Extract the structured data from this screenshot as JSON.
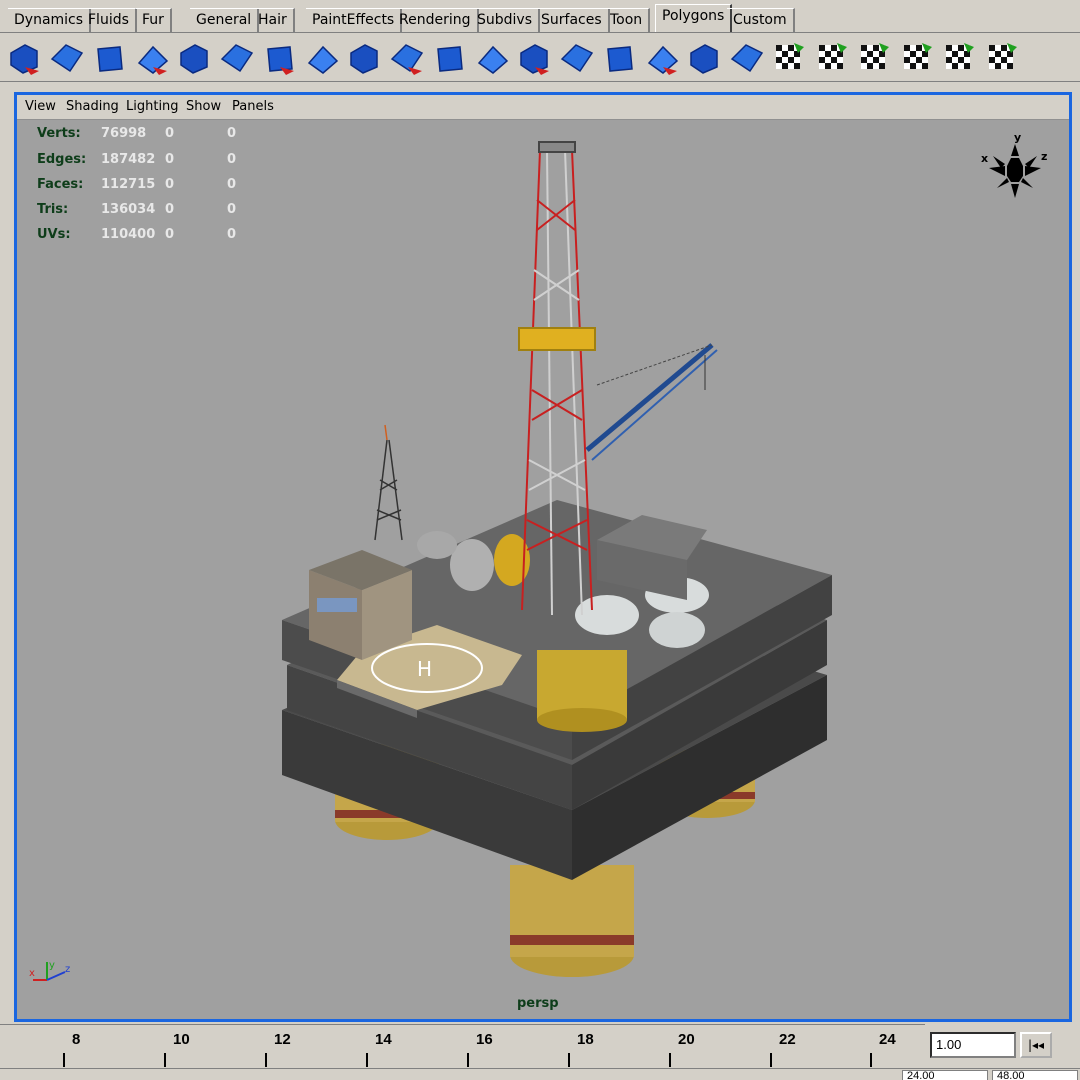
{
  "shelf_tabs": [
    {
      "label": "Dynamics"
    },
    {
      "label": "Fluids"
    },
    {
      "label": "Fur"
    },
    {
      "label": "General"
    },
    {
      "label": "Hair"
    },
    {
      "label": "PaintEffects"
    },
    {
      "label": "Rendering"
    },
    {
      "label": "Subdivs"
    },
    {
      "label": "Surfaces"
    },
    {
      "label": "Toon"
    },
    {
      "label": "Polygons",
      "active": true
    },
    {
      "label": "Custom"
    }
  ],
  "shelf_tools": [
    "sphere-select-icon",
    "cube-scatter-icon",
    "sphere-arrow-icon",
    "cube-sphere-icon",
    "cube-wire-icon",
    "plane-grid-icon",
    "plane-cut-icon",
    "cube-extrude-icon",
    "face-split-icon",
    "face-bevel-icon",
    "face-extrude-icon",
    "face-merge-icon",
    "edge-loop-icon",
    "edge-split-icon",
    "face-wedge-icon",
    "face-lift-icon",
    "face-duplicate-icon",
    "plane-pivot-icon",
    "uv-checker-icon",
    "uv-map-icon",
    "uv-cylinder-icon",
    "uv-sphere-icon",
    "uv-project-icon",
    "uv-editor-icon"
  ],
  "panel_menu": {
    "view": "View",
    "shading": "Shading",
    "lighting": "Lighting",
    "show": "Show",
    "panels": "Panels"
  },
  "hud": {
    "rows": [
      {
        "label": "Verts:",
        "v1": "76998",
        "v2": "0",
        "v3": "0"
      },
      {
        "label": "Edges:",
        "v1": "187482",
        "v2": "0",
        "v3": "0"
      },
      {
        "label": "Faces:",
        "v1": "112715",
        "v2": "0",
        "v3": "0"
      },
      {
        "label": "Tris:",
        "v1": "136034",
        "v2": "0",
        "v3": "0"
      },
      {
        "label": "UVs:",
        "v1": "110400",
        "v2": "0",
        "v3": "0"
      }
    ]
  },
  "camera_name": "persp",
  "view_cube_axes": {
    "x": "x",
    "y": "y",
    "z": "z"
  },
  "axis_gizmo": {
    "x": "x",
    "y": "y",
    "z": "z"
  },
  "timeline": {
    "ticks": [
      "8",
      "10",
      "12",
      "14",
      "16",
      "18",
      "20",
      "22",
      "24"
    ],
    "current_frame": "1.00",
    "range_start": "24.00",
    "range_end": "48.00"
  },
  "colors": {
    "viewport_bg": "#a0a0a0",
    "panel_border": "#1a66e0",
    "hud_label": "#0e3d1a",
    "hud_value": "#e8e8e8"
  }
}
